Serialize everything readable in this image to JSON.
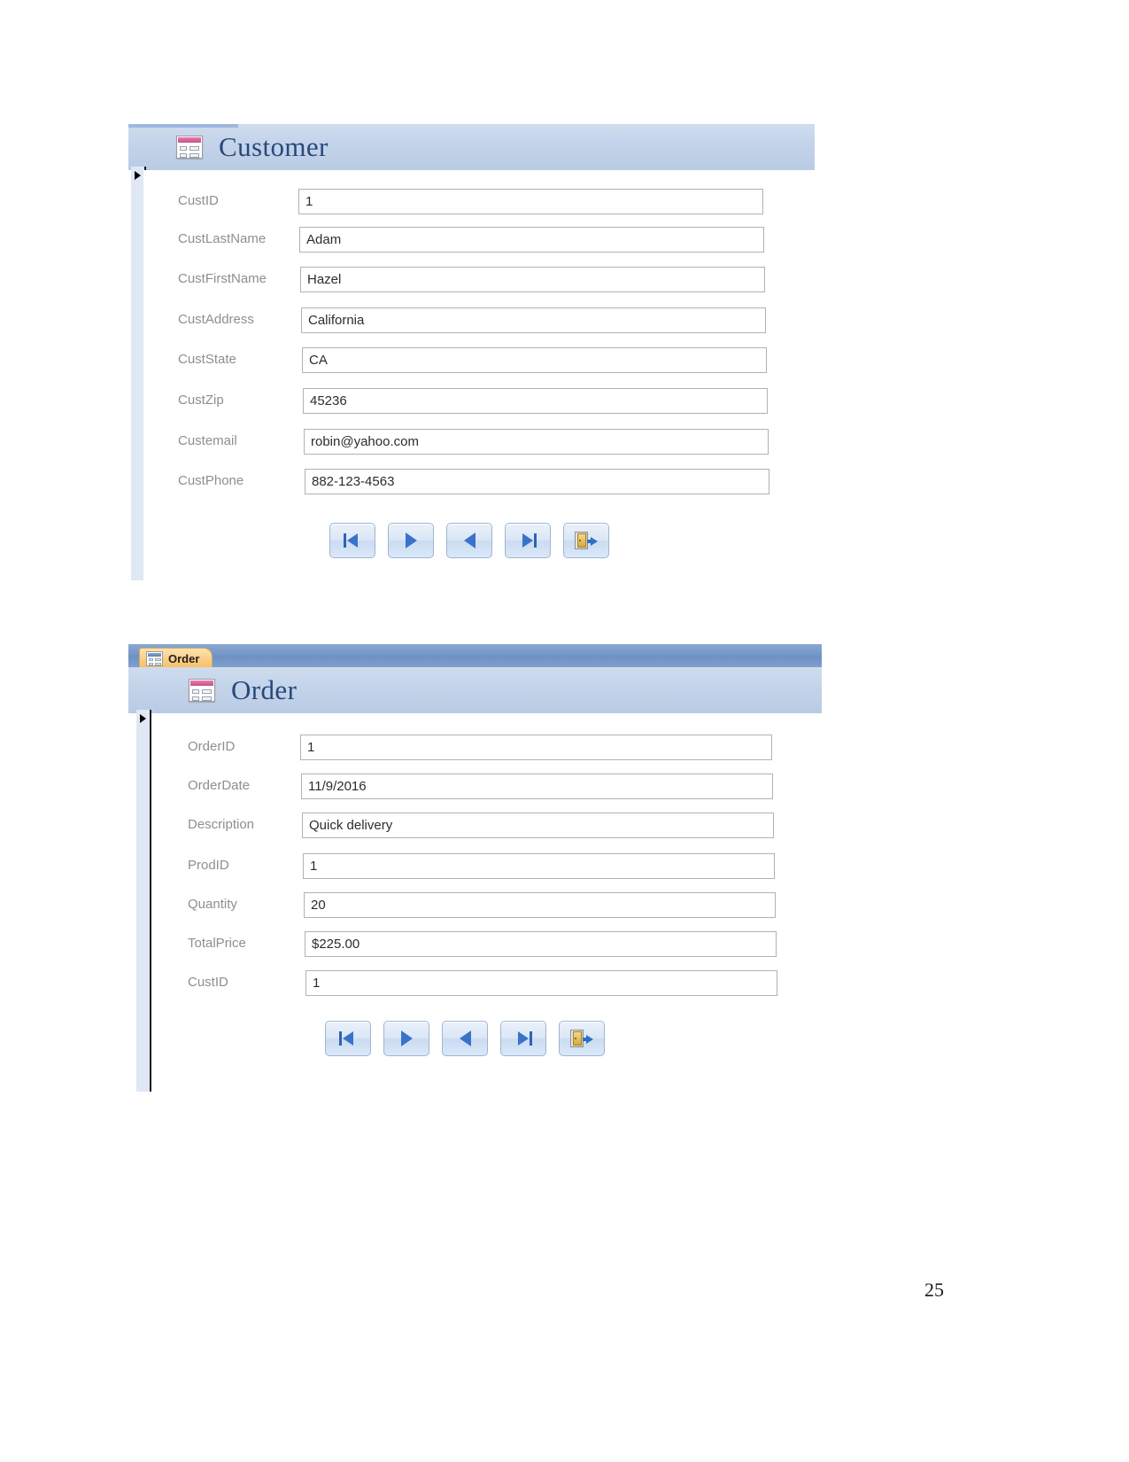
{
  "page": {
    "number": "25"
  },
  "customer_form": {
    "title": "Customer",
    "icon": "form-icon",
    "fields": [
      {
        "label": "CustID",
        "value": "1"
      },
      {
        "label": "CustLastName",
        "value": "Adam"
      },
      {
        "label": "CustFirstName",
        "value": "Hazel"
      },
      {
        "label": "CustAddress",
        "value": "California"
      },
      {
        "label": "CustState",
        "value": "CA"
      },
      {
        "label": "CustZip",
        "value": "45236"
      },
      {
        "label": "Custemail",
        "value": "robin@yahoo.com"
      },
      {
        "label": "CustPhone",
        "value": "882-123-4563"
      }
    ],
    "nav_buttons": [
      {
        "name": "first-record-button",
        "icon": "first-record-icon"
      },
      {
        "name": "next-record-button",
        "icon": "next-record-icon"
      },
      {
        "name": "previous-record-button",
        "icon": "previous-record-icon"
      },
      {
        "name": "last-record-button",
        "icon": "last-record-icon"
      },
      {
        "name": "close-form-button",
        "icon": "exit-door-icon"
      }
    ]
  },
  "order_form": {
    "tab_label": "Order",
    "title": "Order",
    "icon": "form-icon",
    "fields": [
      {
        "label": "OrderID",
        "value": "1"
      },
      {
        "label": "OrderDate",
        "value": "11/9/2016"
      },
      {
        "label": "Description",
        "value": "Quick delivery"
      },
      {
        "label": "ProdID",
        "value": "1"
      },
      {
        "label": "Quantity",
        "value": "20"
      },
      {
        "label": "TotalPrice",
        "value": "$225.00"
      },
      {
        "label": "CustID",
        "value": "1"
      }
    ],
    "nav_buttons": [
      {
        "name": "first-record-button",
        "icon": "first-record-icon"
      },
      {
        "name": "next-record-button",
        "icon": "next-record-icon"
      },
      {
        "name": "previous-record-button",
        "icon": "previous-record-icon"
      },
      {
        "name": "last-record-button",
        "icon": "last-record-icon"
      },
      {
        "name": "close-form-button",
        "icon": "exit-door-icon"
      }
    ]
  },
  "colors": {
    "header_band": "#c3d3e9",
    "title_text": "#28497a",
    "tab_active": "#f7bf62",
    "tab_strip": "#6e92c4",
    "label_text": "#8b8f94",
    "nav_button": "#dbe7f6"
  }
}
